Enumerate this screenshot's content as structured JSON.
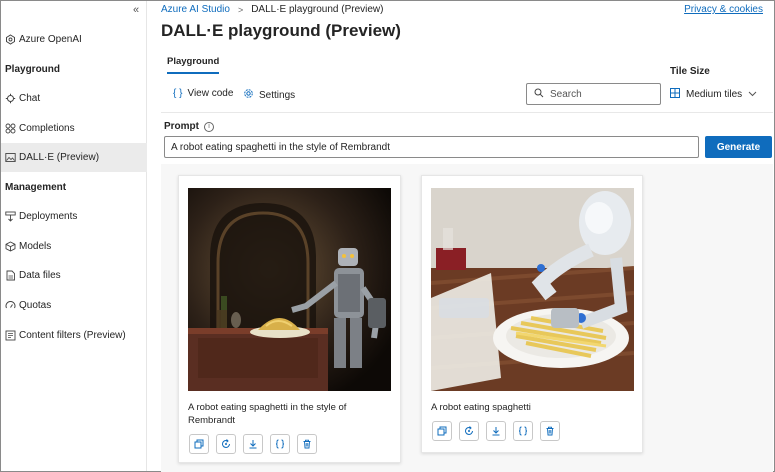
{
  "sidebar": {
    "collapse_glyph": "«",
    "items": [
      {
        "label": "Azure OpenAI",
        "icon": "azure-openai-icon"
      },
      {
        "label": "Playground",
        "section": true
      },
      {
        "label": "Chat",
        "icon": "chat-icon"
      },
      {
        "label": "Completions",
        "icon": "completions-icon"
      },
      {
        "label": "DALL·E (Preview)",
        "icon": "dalle-icon",
        "active": true
      },
      {
        "label": "Management",
        "section": true
      },
      {
        "label": "Deployments",
        "icon": "deployments-icon"
      },
      {
        "label": "Models",
        "icon": "models-icon"
      },
      {
        "label": "Data files",
        "icon": "data-files-icon"
      },
      {
        "label": "Quotas",
        "icon": "quotas-icon"
      },
      {
        "label": "Content filters (Preview)",
        "icon": "content-filters-icon"
      }
    ]
  },
  "header": {
    "breadcrumb_root": "Azure AI Studio",
    "breadcrumb_sep": ">",
    "breadcrumb_current": "DALL·E playground (Preview)",
    "privacy_link": "Privacy & cookies",
    "title": "DALL·E playground (Preview)"
  },
  "tabs": [
    {
      "label": "Playground",
      "active": true
    }
  ],
  "toolbar": {
    "view_code_icon": "{ }",
    "view_code_label": "View code",
    "settings_label": "Settings",
    "search_placeholder": "Search",
    "tile_size_label": "Tile Size",
    "tile_size_value": "Medium tiles"
  },
  "prompt": {
    "label": "Prompt",
    "info_glyph": "i",
    "value": "A robot eating spaghetti in the style of Rembrandt",
    "generate_label": "Generate"
  },
  "results": [
    {
      "caption": "A robot eating spaghetti in the style of Rembrandt",
      "image": "robot-rembrandt-image"
    },
    {
      "caption": "A robot eating spaghetti",
      "image": "robot-spaghetti-image"
    }
  ],
  "card_actions": [
    "copy-icon",
    "regenerate-icon",
    "download-icon",
    "code-icon",
    "delete-icon"
  ],
  "colors": {
    "accent": "#0f6cbd",
    "active_nav": "#ebebeb"
  }
}
